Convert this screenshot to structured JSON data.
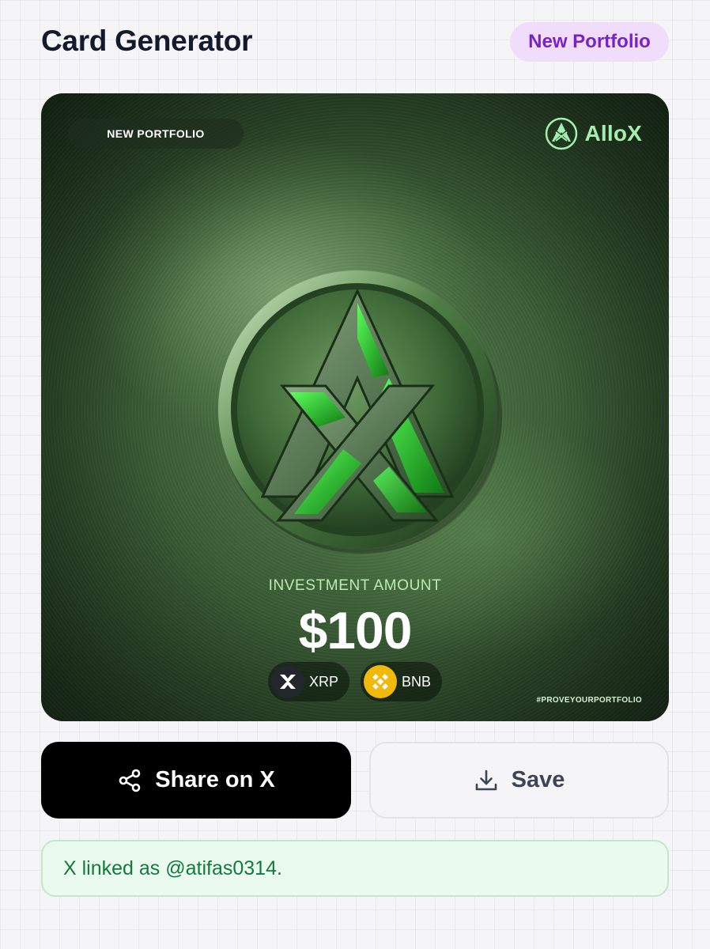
{
  "header": {
    "title": "Card Generator",
    "badge": "New Portfolio"
  },
  "card": {
    "tag": "NEW PORTFOLIO",
    "brand_name": "AlloX",
    "investment_label": "INVESTMENT AMOUNT",
    "investment_amount": "$100",
    "tokens": [
      {
        "symbol": "XRP",
        "icon": "xrp-icon"
      },
      {
        "symbol": "BNB",
        "icon": "bnb-icon"
      }
    ],
    "hashtag": "#PROVEYOURPORTFOLIO",
    "accent_color": "#a4eeb0"
  },
  "actions": {
    "share_label": "Share on X",
    "share_icon": "share-icon",
    "save_label": "Save",
    "save_icon": "download-icon"
  },
  "status": {
    "message": "X linked as @atifas0314.",
    "color": "#137a3e"
  }
}
